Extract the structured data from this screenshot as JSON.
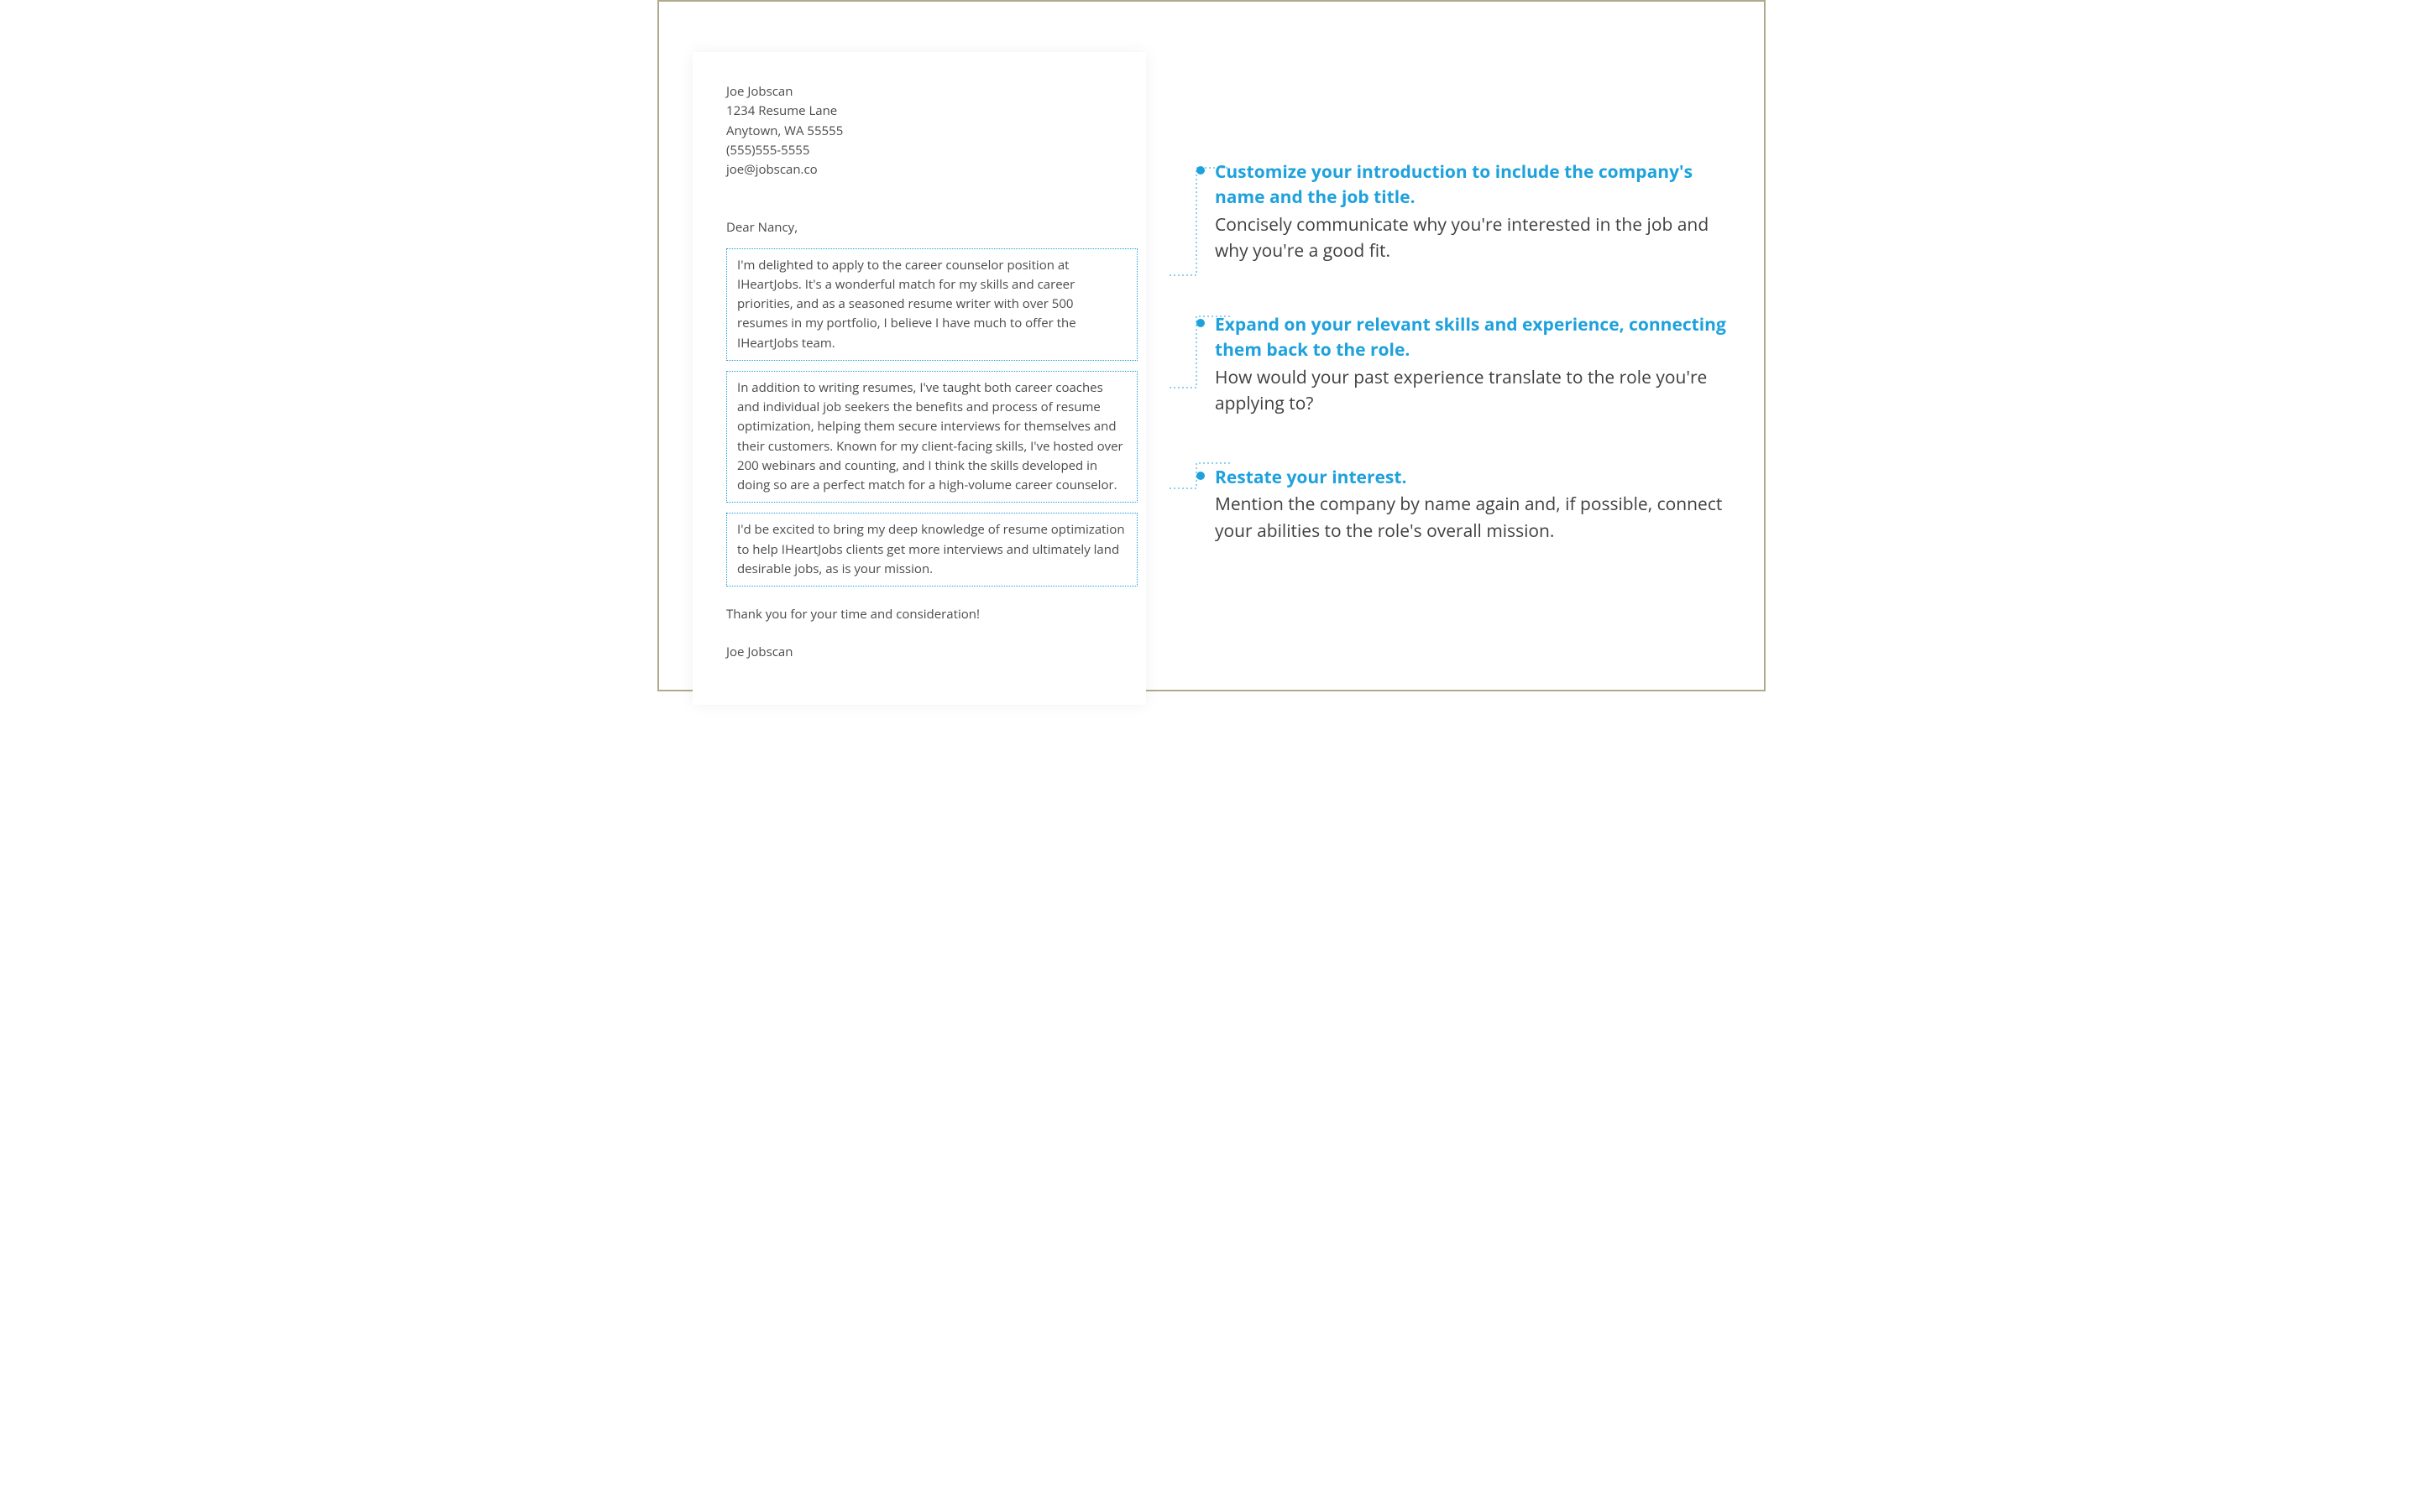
{
  "letter": {
    "sender": {
      "name": "Joe Jobscan",
      "street": "1234 Resume Lane",
      "city_state_zip": "Anytown, WA 55555",
      "phone": "(555)555-5555",
      "email": "joe@jobscan.co"
    },
    "salutation": "Dear Nancy,",
    "paragraphs": {
      "p1": "I'm delighted to apply to the career counselor position at IHeartJobs. It's a wonderful match for my skills and career priorities, and as a seasoned resume writer with over 500 resumes in my portfolio, I believe I have much to offer the IHeartJobs team.",
      "p2": "In addition to writing resumes, I've taught both career coaches and individual job seekers the benefits and process of resume optimization, helping them secure interviews for themselves and their customers. Known for my client-facing skills, I've hosted over 200 webinars and counting, and I think the skills developed in doing so are a perfect match for a high-volume career counselor.",
      "p3": "I'd be excited to bring my deep knowledge of resume optimization to help IHeartJobs clients get more interviews and ultimately land desirable jobs, as is your mission."
    },
    "closing": "Thank you for your time and consideration!",
    "signature": "Joe Jobscan"
  },
  "tips": {
    "t1": {
      "title": "Customize your introduction to include the company's name and the job title.",
      "body": "Concisely communicate why you're interested in the job and why you're a good fit."
    },
    "t2": {
      "title": "Expand on your relevant skills and experience, connecting them back to the role.",
      "body": "How would your past experience translate to the role you're applying to?"
    },
    "t3": {
      "title": "Restate your interest.",
      "body": "Mention the company by name again and, if possible, connect your abilities to the role's overall mission."
    }
  },
  "colors": {
    "accent": "#1ea1dc",
    "text": "#4a4a4a",
    "border": "#b0aa8c"
  }
}
